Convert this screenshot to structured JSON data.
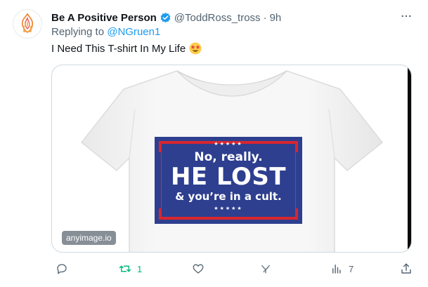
{
  "tweet": {
    "author": {
      "display_name": "Be A Positive Person",
      "handle": "@ToddRoss_tross",
      "verified": true
    },
    "separator": "·",
    "time": "9h",
    "reply": {
      "prefix": "Replying to ",
      "mention": "@NGruen1"
    },
    "text": "I Need This T-shirt In My Life",
    "emoji": "star-struck-emoji",
    "more_icon": "more-horizontal-icon",
    "media": {
      "shirt_print": {
        "stars_top": "★★★★★",
        "line1": "No, really.",
        "line2": "HE LOST",
        "line3": "& you’re in a cult.",
        "stars_bottom": "★★★★★"
      },
      "watermark": "anyimage.io"
    },
    "actions": {
      "reply": {
        "icon": "reply-icon",
        "count": ""
      },
      "retweet": {
        "icon": "retweet-icon",
        "count": "1"
      },
      "like": {
        "icon": "heart-icon",
        "count": ""
      },
      "grok": {
        "icon": "grok-icon",
        "count": ""
      },
      "views": {
        "icon": "views-icon",
        "count": "7"
      },
      "share": {
        "icon": "share-icon",
        "count": ""
      }
    },
    "colors": {
      "accent": "#1d9bf0",
      "retweet_active": "#00ba7c",
      "secondary_text": "#536471",
      "print_blue": "#2e3f8f",
      "print_red": "#d8262f"
    }
  }
}
